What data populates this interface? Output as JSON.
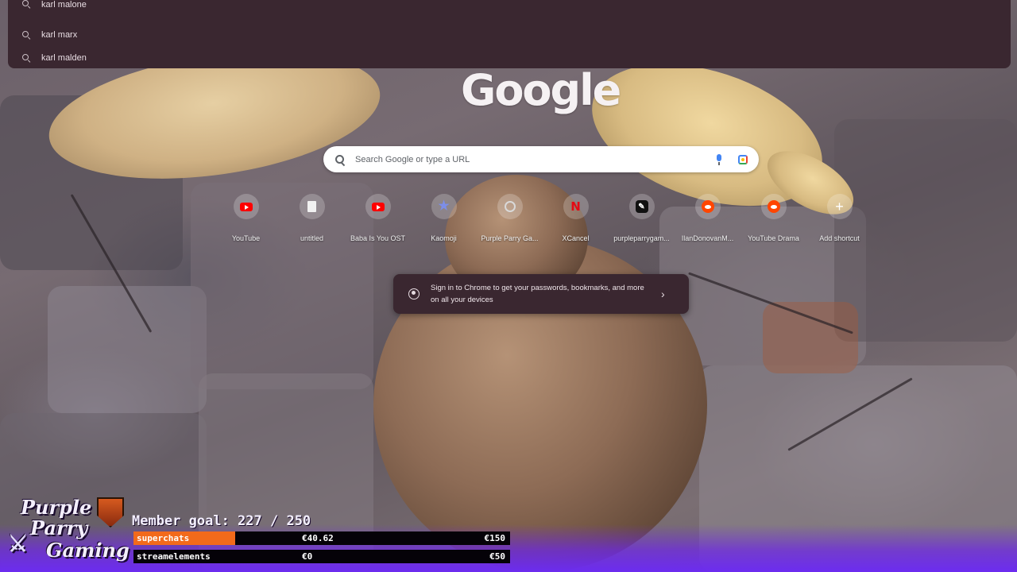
{
  "omnibox": {
    "suggestions": [
      {
        "text": "karl malone"
      },
      {
        "text": "karl marx"
      },
      {
        "text": "karl malden"
      }
    ]
  },
  "ntp": {
    "logo_text": "Google",
    "search_placeholder": "Search Google or type a URL",
    "shortcuts": [
      {
        "label": "YouTube",
        "icon": "youtube-icon"
      },
      {
        "label": "untitled",
        "icon": "document-icon"
      },
      {
        "label": "Baba Is You OST",
        "icon": "youtube-icon"
      },
      {
        "label": "Kaomoji",
        "icon": "star-icon"
      },
      {
        "label": "Purple Parry Ga...",
        "icon": "steam-icon"
      },
      {
        "label": "XCancel",
        "icon": "netflix-n-icon"
      },
      {
        "label": "purpleparrygam...",
        "icon": "pen-icon"
      },
      {
        "label": "IlanDonovanM...",
        "icon": "reddit-icon"
      },
      {
        "label": "YouTube Drama",
        "icon": "reddit-icon"
      },
      {
        "label": "Add shortcut",
        "icon": "plus-icon"
      }
    ],
    "signin_toast": "Sign in to Chrome to get your passwords, bookmarks, and more on all your devices"
  },
  "overlay": {
    "brand": {
      "line1": "Purple",
      "line2": "Parry",
      "line3": "Gaming"
    },
    "member_goal": "Member goal: 227 / 250",
    "member_current": 227,
    "member_target": 250,
    "bars": [
      {
        "name": "superchats",
        "current": "€40.62",
        "goal": "€150",
        "fill": 0.2708,
        "color": "#f26a1b"
      },
      {
        "name": "streamelements",
        "current": "€0",
        "goal": "€50",
        "fill": 0,
        "color": "#f26a1b"
      }
    ]
  },
  "colors": {
    "dropdown_bg": "#3a2730",
    "overlay_purple": "#6c2cf0",
    "bar_fill": "#f26a1b"
  }
}
